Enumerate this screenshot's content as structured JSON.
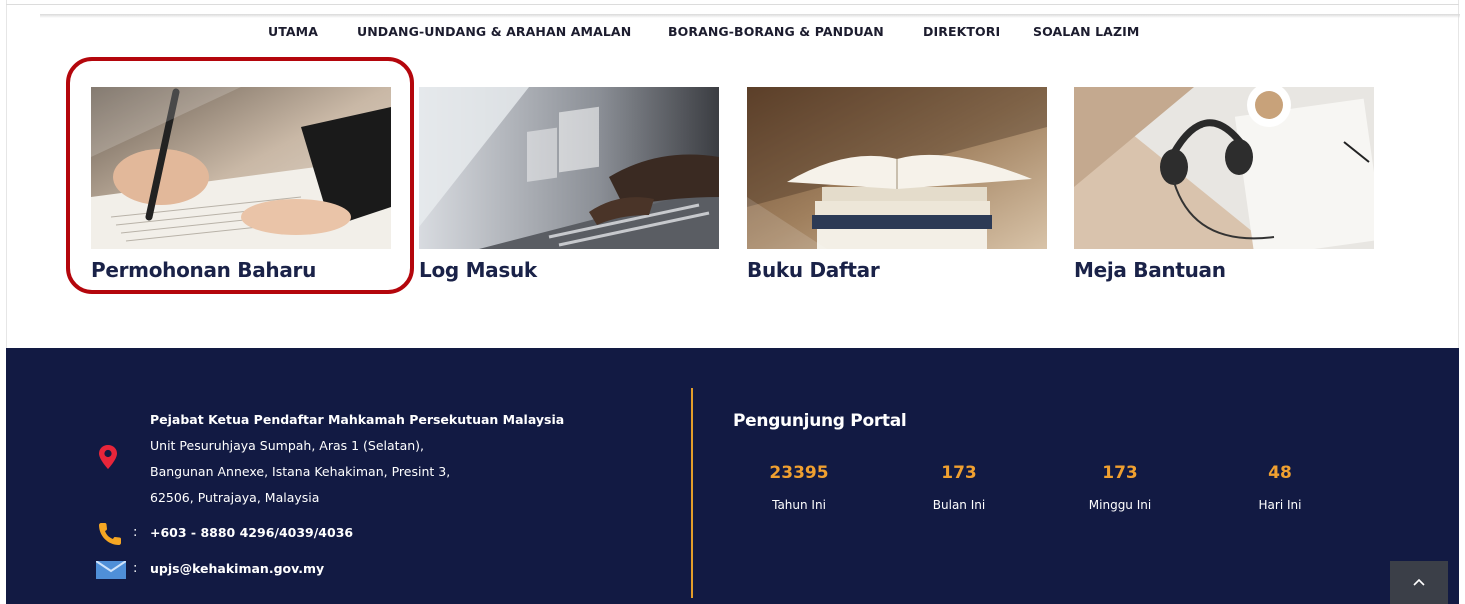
{
  "nav": {
    "items": [
      {
        "label": "UTAMA"
      },
      {
        "label": "UNDANG-UNDANG & ARAHAN AMALAN"
      },
      {
        "label": "BORANG-BORANG & PANDUAN"
      },
      {
        "label": "DIREKTORI"
      },
      {
        "label": "SOALAN LAZIM"
      }
    ]
  },
  "cards": [
    {
      "title": "Permohonan Baharu",
      "image": "hand-writing-with-pen"
    },
    {
      "title": "Log Masuk",
      "image": "hands-typing-on-laptop"
    },
    {
      "title": "Buku Daftar",
      "image": "stack-of-open-books"
    },
    {
      "title": "Meja Bantuan",
      "image": "headphones-on-desk"
    }
  ],
  "footer": {
    "address": {
      "title": "Pejabat Ketua Pendaftar Mahkamah Persekutuan Malaysia",
      "lines": [
        "Unit Pesuruhjaya Sumpah, Aras 1 (Selatan),",
        "Bangunan Annexe, Istana Kehakiman, Presint 3,",
        "62506, Putrajaya, Malaysia"
      ],
      "icon": "location-pin-icon"
    },
    "phone": {
      "colon": ":",
      "value": "+603 - 8880 4296/4039/4036",
      "icon": "phone-icon"
    },
    "email": {
      "colon": ":",
      "value": "upjs@kehakiman.gov.my",
      "icon": "mail-icon"
    },
    "stats": {
      "title": "Pengunjung Portal",
      "items": [
        {
          "value": "23395",
          "label": "Tahun Ini"
        },
        {
          "value": "173",
          "label": "Bulan Ini"
        },
        {
          "value": "173",
          "label": "Minggu Ini"
        },
        {
          "value": "48",
          "label": "Hari Ini"
        }
      ]
    }
  },
  "colors": {
    "footer_bg": "#121a43",
    "accent": "#f0a030",
    "highlight": "#b4060c",
    "title_text": "#1a2248"
  },
  "back_to_top": {
    "icon": "chevron-up-icon"
  }
}
